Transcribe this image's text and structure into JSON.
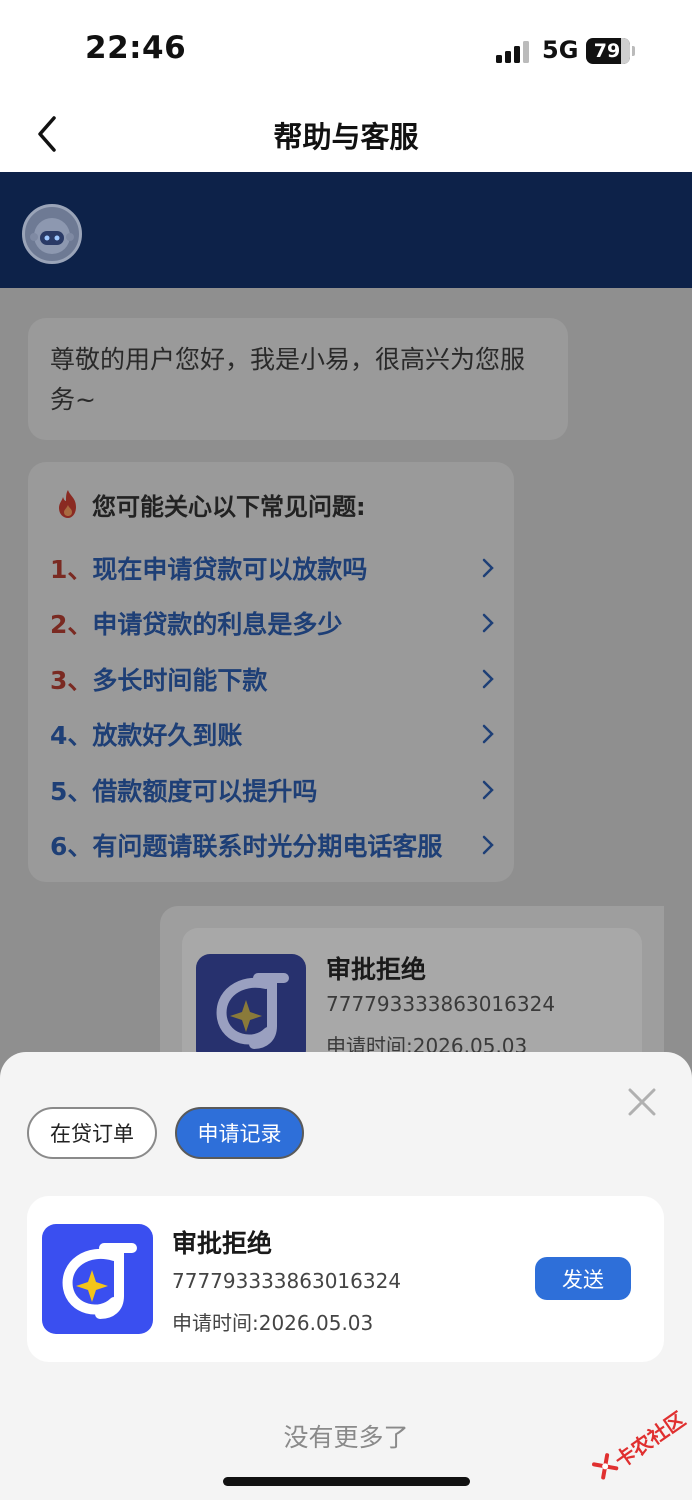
{
  "status_bar": {
    "time": "22:46",
    "network": "5G",
    "battery": "79",
    "battery_fraction": 0.79
  },
  "nav": {
    "title": "帮助与客服"
  },
  "chat": {
    "greeting": "尊敬的用户您好，我是小易，很高兴为您服务~",
    "faq_title": "您可能关心以下常见问题:",
    "faq_items": [
      {
        "num": "1、",
        "text": "现在申请贷款可以放款吗"
      },
      {
        "num": "2、",
        "text": "申请贷款的利息是多少"
      },
      {
        "num": "3、",
        "text": "多长时间能下款"
      },
      {
        "num": "4、",
        "text": "放款好久到账"
      },
      {
        "num": "5、",
        "text": "借款额度可以提升吗"
      },
      {
        "num": "6、",
        "text": "有问题请联系时光分期电话客服"
      }
    ],
    "sent_card": {
      "status": "审批拒绝",
      "id": "777793333863016324",
      "time": "申请时间:2026.05.03"
    }
  },
  "sheet": {
    "tabs": [
      "在贷订单",
      "申请记录"
    ],
    "active_tab": "申请记录",
    "record": {
      "status": "审批拒绝",
      "id": "777793333863016324",
      "time": "申请时间:2026.05.03",
      "send_label": "发送"
    },
    "no_more": "没有更多了"
  },
  "watermark": "卡农社区",
  "colors": {
    "accent": "#2e6fd9",
    "header_band": "#0d2249",
    "logo_bg": "#3a4ff0",
    "faq_text": "#1e3f76"
  }
}
